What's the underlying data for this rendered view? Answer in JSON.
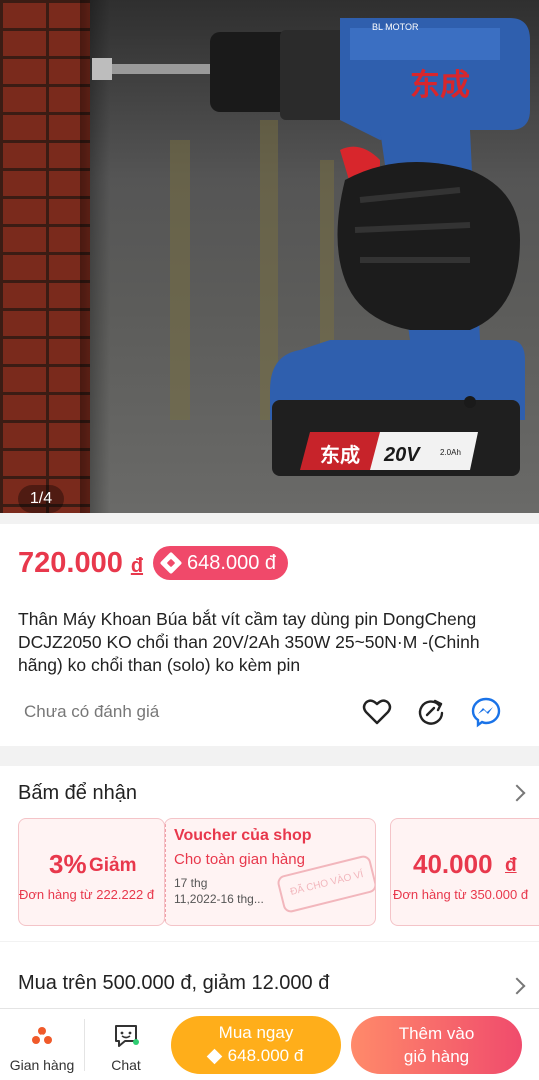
{
  "gallery": {
    "counter": "1/4"
  },
  "price": {
    "main": "720.000",
    "currency": "đ",
    "promo": "648.000 đ"
  },
  "product": {
    "title": "Thân Máy Khoan Búa bắt vít cầm tay dùng pin DongCheng DCJZ2050 KO chổi than  20V/2Ah 350W  25~50N·M  -(Chinh hãng)  ko chổi than (solo) ko kèm pin",
    "rating_text": "Chưa có đánh giá",
    "drill_brand_text": "东成",
    "battery_voltage": "20V",
    "battery_capacity": "2.0Ah",
    "motor_label": "BL MOTOR"
  },
  "actions": {
    "favorite_icon": "heart-icon",
    "share_icon": "share-icon",
    "messenger_icon": "messenger-icon"
  },
  "vouchers": {
    "title": "Bấm để nhận",
    "items": [
      {
        "amount": "3%",
        "unit": "Giảm",
        "condition": "Đơn hàng từ 222.222 đ"
      },
      {
        "heading": "Voucher của shop",
        "scope": "Cho toàn gian hàng",
        "validity_line1": "17 thg",
        "validity_line2": "11,2022-16 thg...",
        "stamp": "ĐÃ CHO VÀO VÍ"
      },
      {
        "amount": "40.000",
        "unit": "đ",
        "condition": "Đơn hàng từ 350.000 đ"
      }
    ]
  },
  "promo": {
    "text": "Mua trên 500.000 đ, giảm 12.000 đ"
  },
  "bottom_bar": {
    "store_label": "Gian hàng",
    "chat_label": "Chat",
    "buy_now_label": "Mua ngay",
    "buy_now_price": "648.000 đ",
    "add_cart_line1": "Thêm vào",
    "add_cart_line2": "giỏ hàng"
  },
  "colors": {
    "accent": "#e8384c",
    "promo_pill": "#f0496a",
    "buy_now": "#ffae1a",
    "cart_start": "#ff8a6a",
    "cart_end": "#f04b6c",
    "drill_blue": "#2f5fae"
  }
}
